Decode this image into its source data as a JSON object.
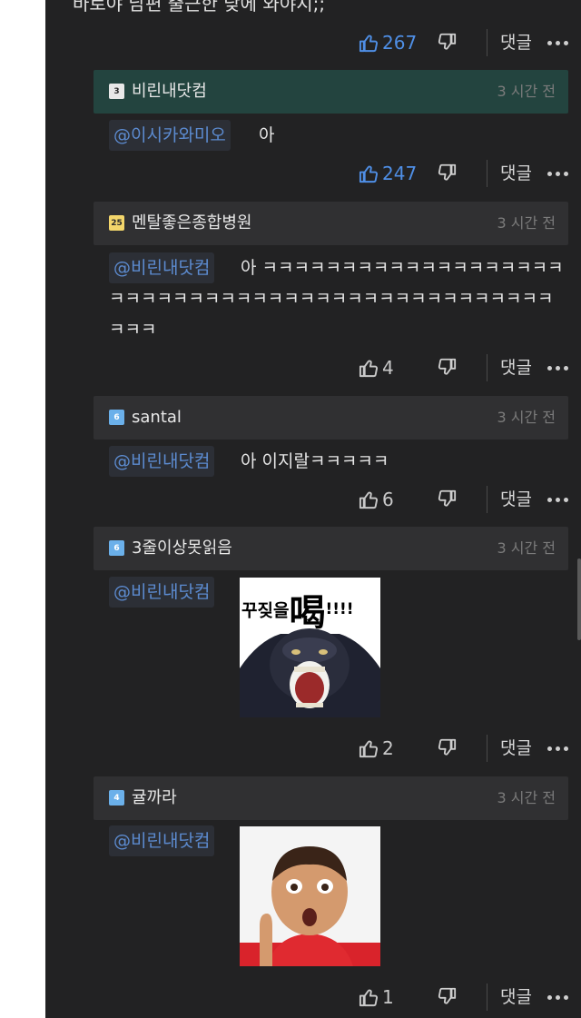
{
  "post": {
    "text": "바로야 남편 출근한 닺에 와야지;;",
    "likes": "267",
    "reply_label": "댓글"
  },
  "comments": [
    {
      "badge": "3",
      "user": "비린내닷컴",
      "time": "3 시간 전",
      "mention": "@이시카와미오",
      "lines": [
        "아"
      ],
      "likes": "247",
      "reply_label": "댓글",
      "highlight": true
    },
    {
      "badge": "25",
      "user": "멘탈좋은종합병원",
      "time": "3 시간 전",
      "mention": "@비린내닷컴",
      "lines": [
        "아 ㅋㅋㅋㅋㅋㅋㅋㅋㅋㅋㅋㅋㅋㅋㅋㅋㅋㅋㅋ",
        "ㅋㅋㅋㅋㅋㅋㅋㅋㅋㅋㅋㅋㅋㅋㅋㅋㅋㅋㅋㅋㅋㅋㅋㅋㅋㅋㅋㅋ",
        "ㅋㅋㅋ"
      ],
      "likes": "4",
      "reply_label": "댓글"
    },
    {
      "badge": "6",
      "user": "santal",
      "time": "3 시간 전",
      "mention": "@비린내닷컴",
      "lines": [
        "아 이지랄ㅋㅋㅋㅋㅋ"
      ],
      "likes": "6",
      "reply_label": "댓글"
    },
    {
      "badge": "6",
      "user": "3줄이상못읽음",
      "time": "3 시간 전",
      "mention": "@비린내닷컴",
      "image_caption_main": "꾸짖을",
      "image_caption_big": "喝",
      "image_caption_tail": "!!!!",
      "likes": "2",
      "reply_label": "댓글"
    },
    {
      "badge": "4",
      "user": "귤까라",
      "time": "3 시간 전",
      "mention": "@비린내닷컴",
      "likes": "1",
      "reply_label": "댓글"
    }
  ],
  "icons": [
    "thumbs-up-icon",
    "thumbs-down-icon",
    "more-dots-icon",
    "level-badge-icon"
  ],
  "colors": {
    "background": "#222223",
    "like_active": "#4f8fe6",
    "mention": "#5c8bd0",
    "header_highlight": "#23443f",
    "header": "#303032"
  }
}
